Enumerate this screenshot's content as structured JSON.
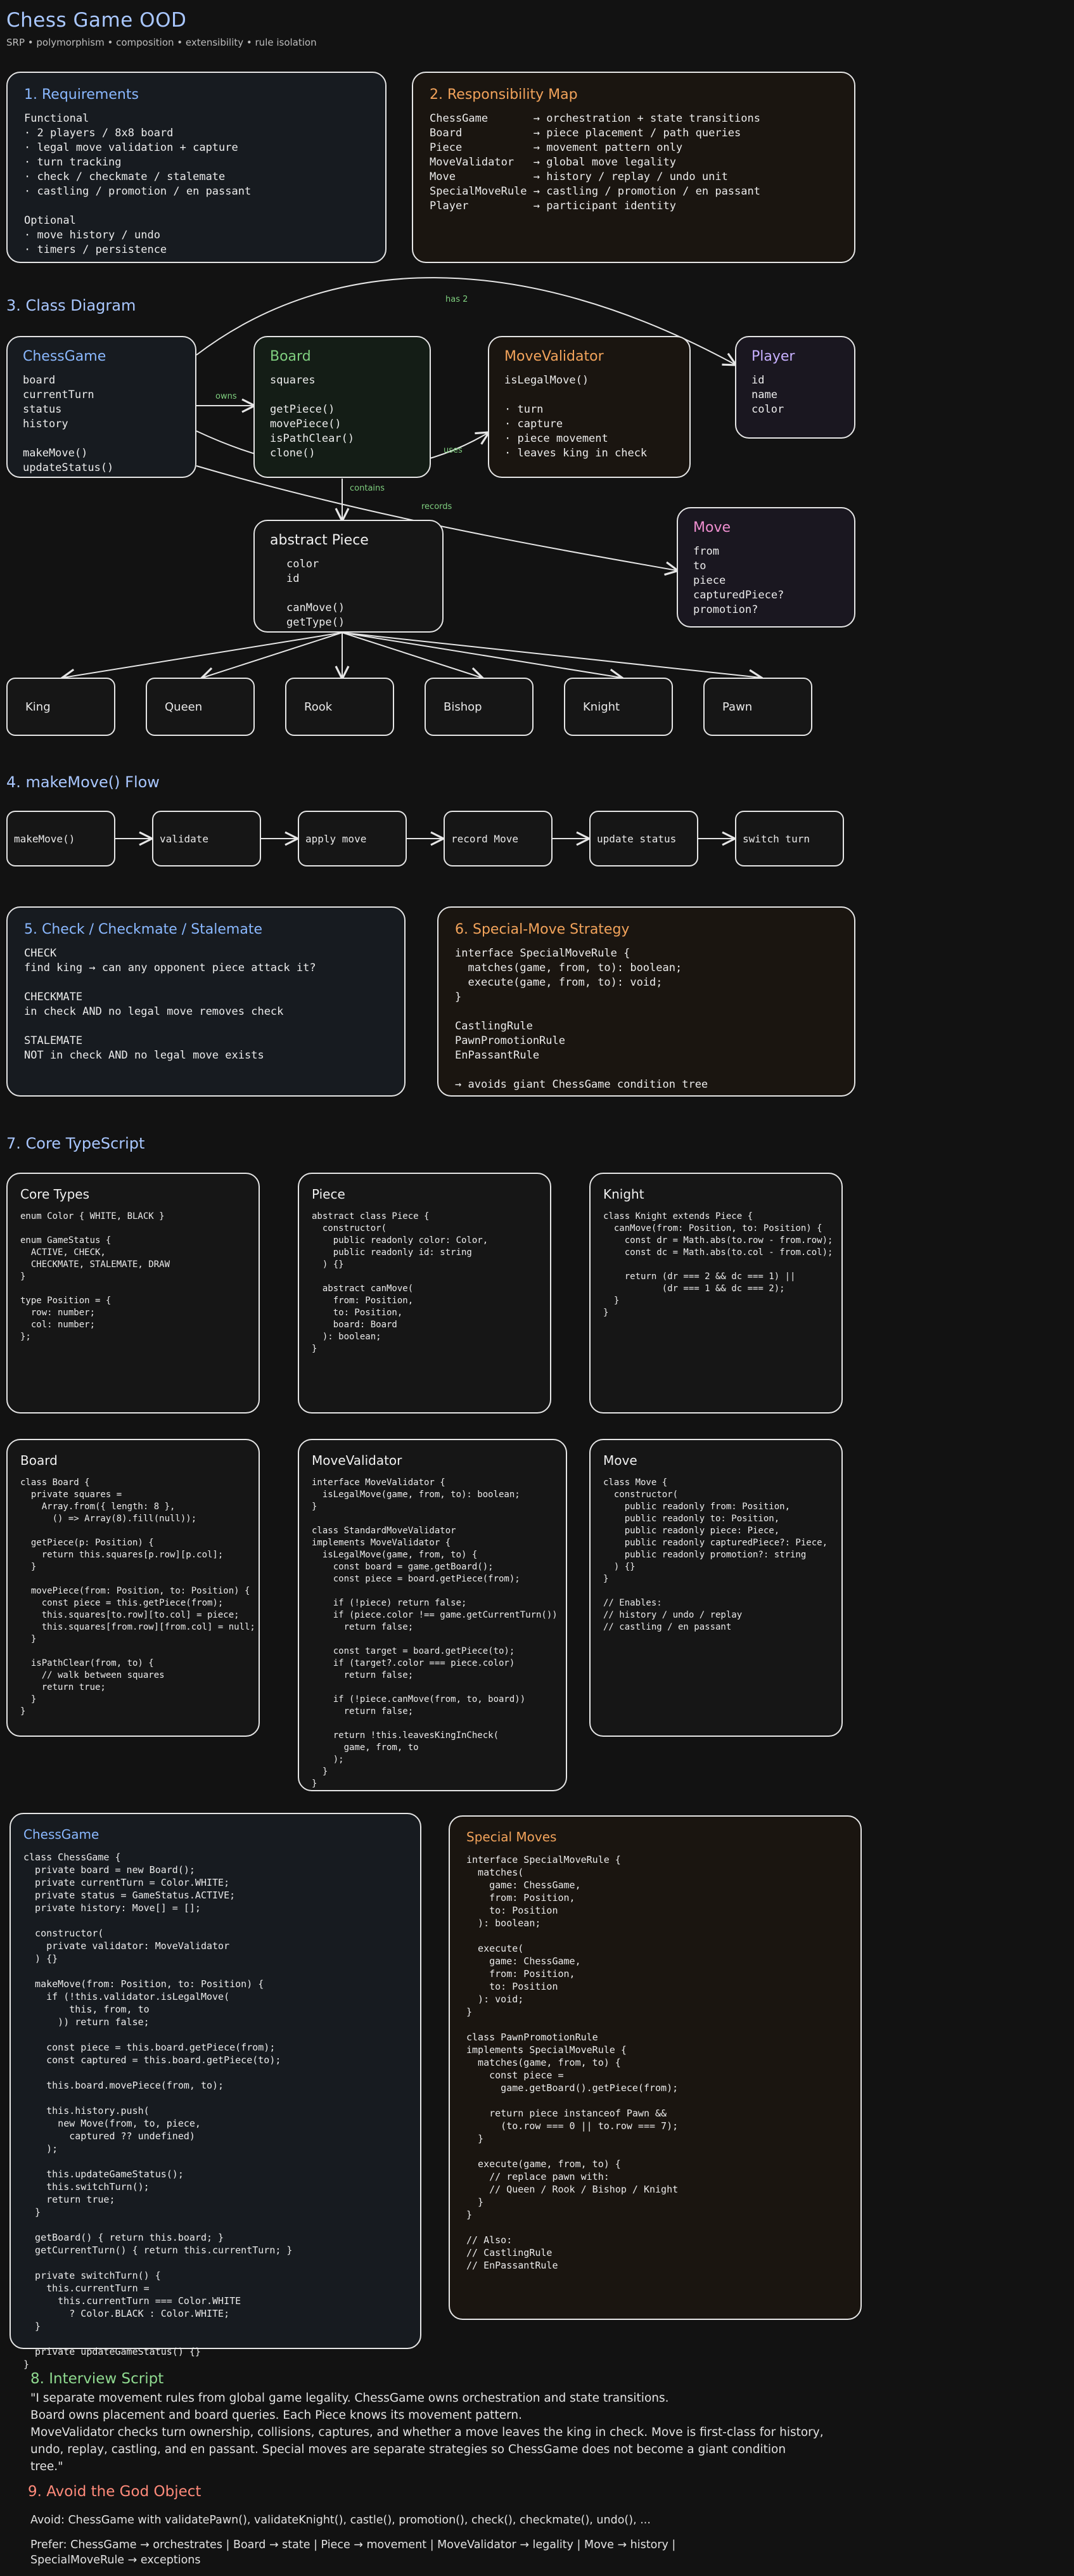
{
  "header": {
    "title": "Chess Game OOD",
    "subtitle": "SRP • polymorphism • composition • extensibility • rule isolation"
  },
  "requirements": {
    "heading": "1. Requirements",
    "body": "Functional\n· 2 players / 8x8 board\n· legal move validation + capture\n· turn tracking\n· check / checkmate / stalemate\n· castling / promotion / en passant\n\nOptional\n· move history / undo\n· timers / persistence"
  },
  "responsibility": {
    "heading": "2. Responsibility Map",
    "body": "ChessGame       → orchestration + state transitions\nBoard           → piece placement / path queries\nPiece           → movement pattern only\nMoveValidator   → global move legality\nMove            → history / replay / undo unit\nSpecialMoveRule → castling / promotion / en passant\nPlayer          → participant identity"
  },
  "class_diagram": {
    "heading": "3. Class Diagram",
    "chessgame": {
      "name": "ChessGame",
      "body": "board\ncurrentTurn\nstatus\nhistory\n\nmakeMove()\nupdateStatus()"
    },
    "board": {
      "name": "Board",
      "body": "squares\n\ngetPiece()\nmovePiece()\nisPathClear()\nclone()"
    },
    "validator": {
      "name": "MoveValidator",
      "body": "isLegalMove()\n\n· turn\n· capture\n· piece movement\n· leaves king in check"
    },
    "player": {
      "name": "Player",
      "body": "id\nname\ncolor"
    },
    "piece": {
      "name": "abstract Piece",
      "body": "color\nid\n\ncanMove()\ngetType()"
    },
    "move": {
      "name": "Move",
      "body": "from\nto\npiece\ncapturedPiece?\npromotion?"
    },
    "edges": {
      "owns": "owns",
      "has2": "has 2",
      "uses": "uses",
      "contains": "contains",
      "records": "records"
    },
    "pieces": [
      "King",
      "Queen",
      "Rook",
      "Bishop",
      "Knight",
      "Pawn"
    ]
  },
  "flow": {
    "heading": "4. makeMove() Flow",
    "steps": [
      "makeMove()",
      "validate",
      "apply move",
      "record Move",
      "update status",
      "switch turn"
    ]
  },
  "check": {
    "heading": "5. Check / Checkmate / Stalemate",
    "body": "CHECK\nfind king → can any opponent piece attack it?\n\nCHECKMATE\nin check AND no legal move removes check\n\nSTALEMATE\nNOT in check AND no legal move exists"
  },
  "strategy": {
    "heading": "6. Special-Move Strategy",
    "body": "interface SpecialMoveRule {\n  matches(game, from, to): boolean;\n  execute(game, from, to): void;\n}\n\nCastlingRule\nPawnPromotionRule\nEnPassantRule\n\n→ avoids giant ChessGame condition tree"
  },
  "core": {
    "heading": "7. Core TypeScript",
    "core_types": {
      "name": "Core Types",
      "code": "enum Color { WHITE, BLACK }\n\nenum GameStatus {\n  ACTIVE, CHECK,\n  CHECKMATE, STALEMATE, DRAW\n}\n\ntype Position = {\n  row: number;\n  col: number;\n};"
    },
    "piece": {
      "name": "Piece",
      "code": "abstract class Piece {\n  constructor(\n    public readonly color: Color,\n    public readonly id: string\n  ) {}\n\n  abstract canMove(\n    from: Position,\n    to: Position,\n    board: Board\n  ): boolean;\n}"
    },
    "knight": {
      "name": "Knight",
      "code": "class Knight extends Piece {\n  canMove(from: Position, to: Position) {\n    const dr = Math.abs(to.row - from.row);\n    const dc = Math.abs(to.col - from.col);\n\n    return (dr === 2 && dc === 1) ||\n           (dr === 1 && dc === 2);\n  }\n}"
    },
    "board": {
      "name": "Board",
      "code": "class Board {\n  private squares =\n    Array.from({ length: 8 },\n      () => Array(8).fill(null));\n\n  getPiece(p: Position) {\n    return this.squares[p.row][p.col];\n  }\n\n  movePiece(from: Position, to: Position) {\n    const piece = this.getPiece(from);\n    this.squares[to.row][to.col] = piece;\n    this.squares[from.row][from.col] = null;\n  }\n\n  isPathClear(from, to) {\n    // walk between squares\n    return true;\n  }\n}"
    },
    "validator": {
      "name": "MoveValidator",
      "code": "interface MoveValidator {\n  isLegalMove(game, from, to): boolean;\n}\n\nclass StandardMoveValidator\nimplements MoveValidator {\n  isLegalMove(game, from, to) {\n    const board = game.getBoard();\n    const piece = board.getPiece(from);\n\n    if (!piece) return false;\n    if (piece.color !== game.getCurrentTurn())\n      return false;\n\n    const target = board.getPiece(to);\n    if (target?.color === piece.color)\n      return false;\n\n    if (!piece.canMove(from, to, board))\n      return false;\n\n    return !this.leavesKingInCheck(\n      game, from, to\n    );\n  }\n}"
    },
    "move": {
      "name": "Move",
      "code": "class Move {\n  constructor(\n    public readonly from: Position,\n    public readonly to: Position,\n    public readonly piece: Piece,\n    public readonly capturedPiece?: Piece,\n    public readonly promotion?: string\n  ) {}\n}\n\n// Enables:\n// history / undo / replay\n// castling / en passant"
    },
    "chessgame": {
      "name": "ChessGame",
      "code": "class ChessGame {\n  private board = new Board();\n  private currentTurn = Color.WHITE;\n  private status = GameStatus.ACTIVE;\n  private history: Move[] = [];\n\n  constructor(\n    private validator: MoveValidator\n  ) {}\n\n  makeMove(from: Position, to: Position) {\n    if (!this.validator.isLegalMove(\n        this, from, to\n      )) return false;\n\n    const piece = this.board.getPiece(from);\n    const captured = this.board.getPiece(to);\n\n    this.board.movePiece(from, to);\n\n    this.history.push(\n      new Move(from, to, piece,\n        captured ?? undefined)\n    );\n\n    this.updateGameStatus();\n    this.switchTurn();\n    return true;\n  }\n\n  getBoard() { return this.board; }\n  getCurrentTurn() { return this.currentTurn; }\n\n  private switchTurn() {\n    this.currentTurn =\n      this.currentTurn === Color.WHITE\n        ? Color.BLACK : Color.WHITE;\n  }\n\n  private updateGameStatus() {}\n}"
    },
    "special": {
      "name": "Special Moves",
      "code": "interface SpecialMoveRule {\n  matches(\n    game: ChessGame,\n    from: Position,\n    to: Position\n  ): boolean;\n\n  execute(\n    game: ChessGame,\n    from: Position,\n    to: Position\n  ): void;\n}\n\nclass PawnPromotionRule\nimplements SpecialMoveRule {\n  matches(game, from, to) {\n    const piece =\n      game.getBoard().getPiece(from);\n\n    return piece instanceof Pawn &&\n      (to.row === 0 || to.row === 7);\n  }\n\n  execute(game, from, to) {\n    // replace pawn with:\n    // Queen / Rook / Bishop / Knight\n  }\n}\n\n// Also:\n// CastlingRule\n// EnPassantRule"
    }
  },
  "interview": {
    "heading": "8. Interview Script",
    "body": "\"I separate movement rules from global game legality. ChessGame owns orchestration and state transitions.\nBoard owns placement and board queries. Each Piece knows its movement pattern.\nMoveValidator checks turn ownership, collisions, captures, and whether a move leaves the king in check. Move is first-class for history,\nundo, replay, castling, and en passant. Special moves are separate strategies so ChessGame does not become a giant condition\ntree.\""
  },
  "god_object": {
    "heading": "9. Avoid the God Object",
    "avoid": "Avoid: ChessGame with validatePawn(), validateKnight(), castle(), promotion(), check(), checkmate(), undo(), ...",
    "prefer": "Prefer: ChessGame → orchestrates | Board → state | Piece → movement | MoveValidator → legality | Move → history |\nSpecialMoveRule → exceptions"
  }
}
